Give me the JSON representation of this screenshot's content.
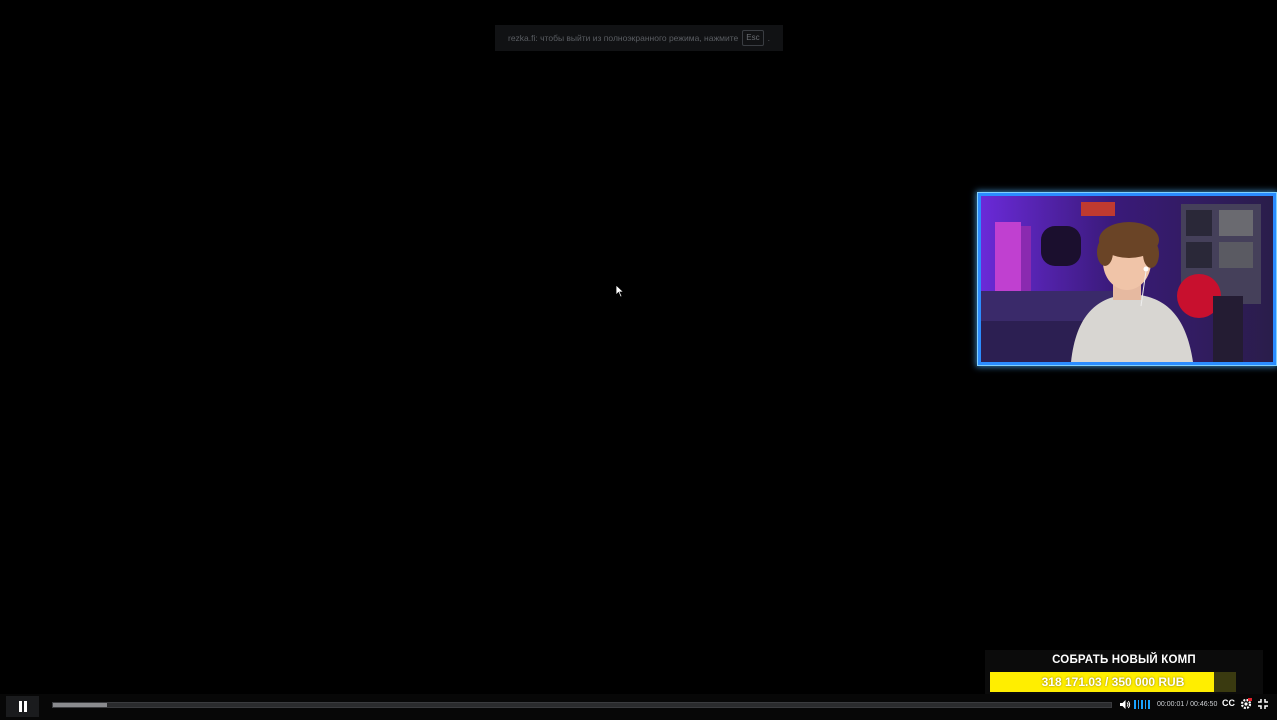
{
  "fullscreen_notice": {
    "text": "rezka.fi: чтобы выйти из полноэкранного режима, нажмите",
    "key": "Esc",
    "suffix": "."
  },
  "overlay": {
    "webcam": "streamer-webcam",
    "goal": {
      "title": "СОБРАТЬ НОВЫЙ КОМП",
      "value_text": "318 171.03 / 350 000 RUB",
      "current": 318171.03,
      "target": 350000,
      "currency": "RUB",
      "bar_color": "#ffee00"
    }
  },
  "player": {
    "state": "playing",
    "play_button_icon": "pause-icon",
    "progress_fraction": 0.0004,
    "buffered_fraction": 0.051,
    "volume_icon": "volume-icon",
    "volume_level": "5 bars",
    "current_time": "00:00:01",
    "duration": "00:46:50",
    "time_separator": " / ",
    "cc_label": "CC",
    "settings_icon": "gear-icon",
    "fullscreen_icon": "exit-fullscreen-icon",
    "accent_color": "#1aa3ff"
  }
}
